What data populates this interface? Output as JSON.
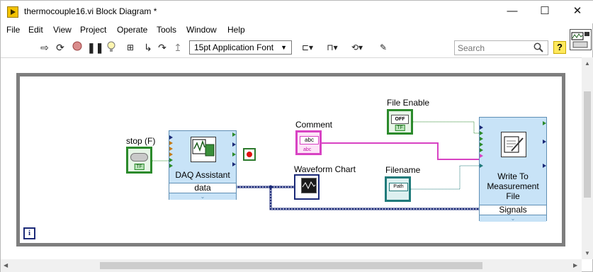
{
  "window": {
    "title": "thermocouple16.vi Block Diagram *",
    "minimize": "—",
    "maximize": "☐",
    "close": "✕"
  },
  "menu": [
    "File",
    "Edit",
    "View",
    "Project",
    "Operate",
    "Tools",
    "Window",
    "Help"
  ],
  "toolbar": {
    "font": "15pt Application Font",
    "search_placeholder": "Search",
    "help": "?"
  },
  "diagram": {
    "stop_label": "stop (F)",
    "stop_tf": "TF",
    "comment_label": "Comment",
    "comment_value": "abc",
    "comment_sub": "abc",
    "file_enable_label": "File Enable",
    "file_enable_value": "OFF",
    "file_enable_tf": "TF",
    "filename_label": "Filename",
    "filename_value": "Path",
    "chart_label": "Waveform Chart",
    "daq_title": "DAQ Assistant",
    "daq_output": "data",
    "wtm_title_1": "Write To",
    "wtm_title_2": "Measurement",
    "wtm_title_3": "File",
    "wtm_input": "Signals",
    "iteration": "i"
  },
  "colors": {
    "boolean_wire": "#2b8a2b",
    "string_wire": "#d843c3",
    "path_wire": "#1f7a7a",
    "dynamic_wire": "#1b2a78",
    "loop_border": "#7e7e7e"
  }
}
